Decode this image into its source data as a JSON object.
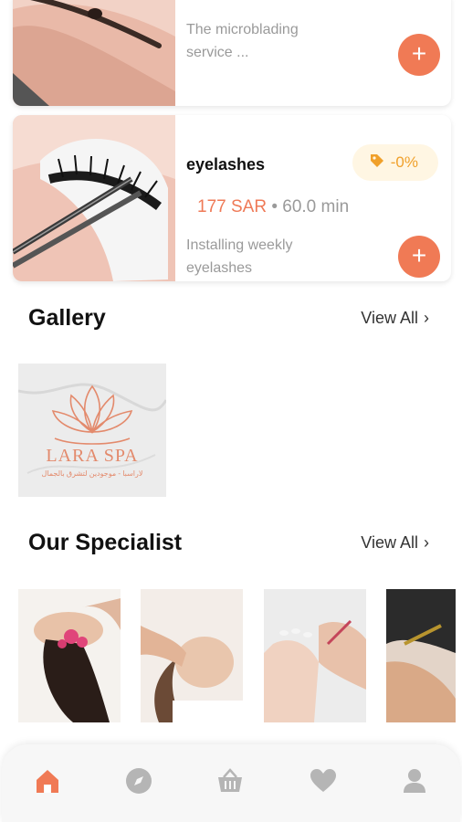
{
  "services": [
    {
      "title": "",
      "description": "The microblading service ...",
      "add_label": "+"
    },
    {
      "title": "eyelashes",
      "discount": "-0%",
      "price": "177 SAR",
      "separator": "•",
      "duration": "60.0 min",
      "description": "Installing weekly eyelashes",
      "add_label": "+"
    }
  ],
  "gallery": {
    "title": "Gallery",
    "view_all": "View All",
    "items": [
      {
        "logo_text": "LARA SPA",
        "logo_subtext": "لاراسبا - موجودين لتشرق بالجمال"
      }
    ]
  },
  "specialists": {
    "title": "Our Specialist",
    "view_all": "View All",
    "count": 4
  },
  "bottom_nav": {
    "items": [
      {
        "icon": "home-icon",
        "active": true
      },
      {
        "icon": "compass-icon",
        "active": false
      },
      {
        "icon": "basket-icon",
        "active": false
      },
      {
        "icon": "heart-icon",
        "active": false
      },
      {
        "icon": "profile-icon",
        "active": false
      }
    ]
  },
  "colors": {
    "accent": "#f07a55",
    "discount_bg": "#fff6e3",
    "discount_text": "#f0a02a",
    "muted": "#9a9a9a"
  }
}
